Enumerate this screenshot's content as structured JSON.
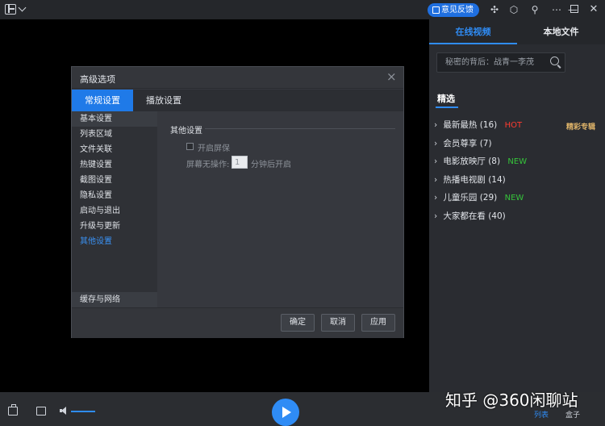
{
  "feedback_label": "意见反馈",
  "right_panel": {
    "tabs": [
      "在线视频",
      "本地文件"
    ],
    "search_placeholder": "秘密的背后：战青一李茂",
    "section_title": "精选",
    "featured_label": "精彩专辑",
    "items": [
      {
        "label": "最新最热",
        "count": "(16)",
        "tag": "HOT",
        "tag_type": "hot"
      },
      {
        "label": "会员尊享",
        "count": "(7)",
        "tag": "",
        "tag_type": ""
      },
      {
        "label": "电影放映厅",
        "count": "(8)",
        "tag": "NEW",
        "tag_type": "new"
      },
      {
        "label": "热播电视剧",
        "count": "(14)",
        "tag": "",
        "tag_type": ""
      },
      {
        "label": "儿童乐园",
        "count": "(29)",
        "tag": "NEW",
        "tag_type": "new"
      },
      {
        "label": "大家都在看",
        "count": "(40)",
        "tag": "",
        "tag_type": ""
      }
    ],
    "arrow_glyph": "›"
  },
  "dialog": {
    "title": "高级选项",
    "close_glyph": "×",
    "tabs": [
      "常规设置",
      "播放设置"
    ],
    "nav_items": [
      "基本设置",
      "列表区域",
      "文件关联",
      "热键设置",
      "截图设置",
      "隐私设置",
      "启动与退出",
      "升级与更新",
      "其他设置"
    ],
    "nav_bottom": "缓存与网络",
    "content": {
      "section_title": "其他设置",
      "checkbox_label": "开启屏保",
      "idle_label": "屏幕无操作:",
      "idle_value": "1",
      "idle_suffix": "分钟后开启"
    },
    "buttons": {
      "ok": "确定",
      "cancel": "取消",
      "apply": "应用"
    }
  },
  "bottom": {
    "mini_tabs": [
      "列表",
      "盒子"
    ],
    "watermark": "知乎 @360闲聊站"
  },
  "colors": {
    "accent": "#2f8cf5",
    "hot": "#ff3b30",
    "new": "#35c43a",
    "featured": "#e0b56a"
  },
  "icons": [
    "app-logo-icon",
    "menu-caret-icon",
    "feedback-edit-icon",
    "skin-icon",
    "box-icon",
    "pin-icon",
    "menu-dots-icon",
    "minimize-icon",
    "maximize-icon",
    "close-icon",
    "search-icon",
    "toolbox-icon",
    "folder-icon",
    "volume-icon",
    "play-icon"
  ]
}
